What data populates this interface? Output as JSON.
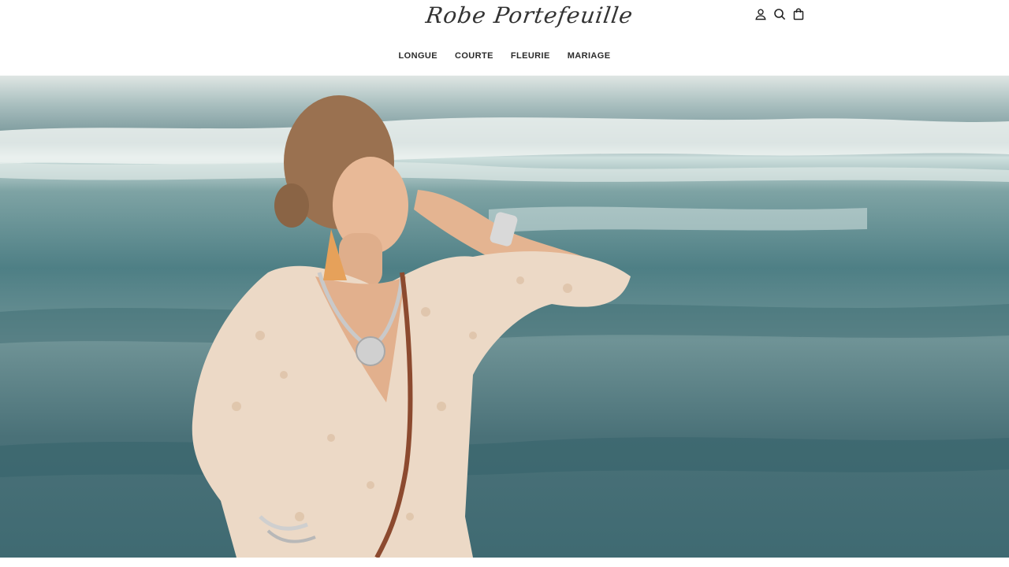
{
  "brand": {
    "logo_text": "Robe Portefeuille"
  },
  "header_icons": [
    {
      "name": "account-icon"
    },
    {
      "name": "search-icon"
    },
    {
      "name": "cart-icon"
    }
  ],
  "nav": {
    "items": [
      {
        "label": "LONGUE"
      },
      {
        "label": "COURTE"
      },
      {
        "label": "FLEURIE"
      },
      {
        "label": "MARIAGE"
      }
    ]
  },
  "hero": {
    "image_subject": "woman-in-wrap-dress-by-sea"
  },
  "colors": {
    "text": "#2b2b2b",
    "background": "#ffffff",
    "sea": "#4e7f85",
    "dress": "#ecd9c6"
  }
}
